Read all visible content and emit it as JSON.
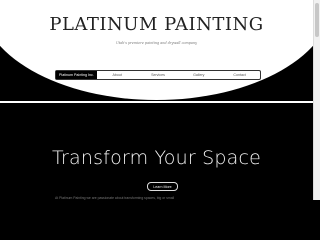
{
  "header": {
    "title": "PLATINUM PAINTING",
    "tagline": "Utah's premiere painting and drywall company"
  },
  "nav": {
    "items": [
      {
        "label": "Platinum Painting Inc.",
        "active": true
      },
      {
        "label": "About",
        "active": false
      },
      {
        "label": "Services",
        "active": false
      },
      {
        "label": "Gallery",
        "active": false
      },
      {
        "label": "Contact",
        "active": false
      }
    ]
  },
  "hero": {
    "title": "Transform Your Space",
    "button_label": "Learn More",
    "footnote": "At Platinum Painting we are passionate about transforming spaces, big or small"
  },
  "colors": {
    "background": "#000000",
    "header": "#ffffff",
    "nav_active": "#000000"
  }
}
